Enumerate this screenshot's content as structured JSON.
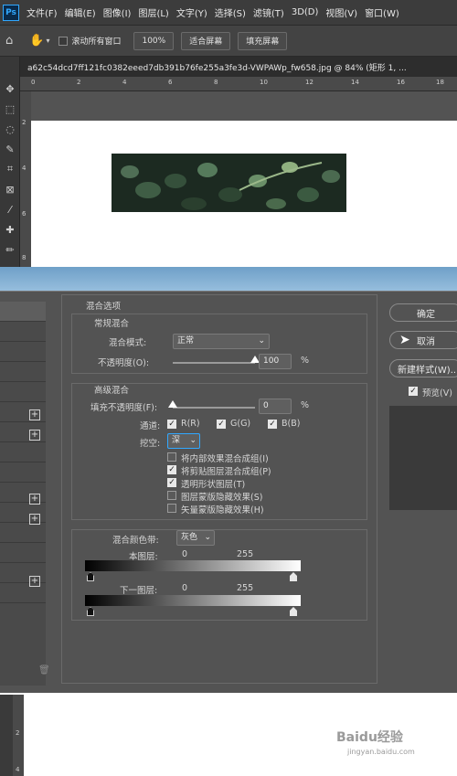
{
  "app": {
    "logo": "Ps"
  },
  "menubar": {
    "items": [
      "文件(F)",
      "编辑(E)",
      "图像(I)",
      "图层(L)",
      "文字(Y)",
      "选择(S)",
      "滤镜(T)",
      "3D(D)",
      "视图(V)",
      "窗口(W)"
    ]
  },
  "options": {
    "scroll_all_label": "滚动所有窗口",
    "zoom_value": "100%",
    "fit_screen": "适合屏幕",
    "fill_screen": "填充屏幕"
  },
  "document": {
    "tab_title": "a62c54dcd7ff121fc0382eeed7db391b76fe255a3fe3d-VWPAWp_fw658.jpg @ 84% (矩形 1, ..."
  },
  "ruler": {
    "top_ticks": [
      "0",
      "2",
      "4",
      "6",
      "8",
      "10",
      "12",
      "14",
      "16",
      "18"
    ],
    "left_ticks": [
      "2",
      "4",
      "6",
      "8"
    ],
    "bottom_left_ticks": [
      "2",
      "4"
    ]
  },
  "dialog": {
    "blend_options": "混合选项",
    "general_blending": "常规混合",
    "blend_mode_label": "混合模式:",
    "blend_mode_value": "正常",
    "opacity_label": "不透明度(O):",
    "opacity_value": "100",
    "opacity_level": 1.0,
    "percent": "%",
    "advanced_blending": "高级混合",
    "fill_opacity_label": "填充不透明度(F):",
    "fill_opacity_value": "0",
    "fill_level": 0.0,
    "channels_label": "通道:",
    "channels": [
      {
        "label": "R(R)",
        "checked": true
      },
      {
        "label": "G(G)",
        "checked": true
      },
      {
        "label": "B(B)",
        "checked": true
      }
    ],
    "knockout_label": "挖空:",
    "knockout_value": "深",
    "options": [
      {
        "label": "将内部效果混合成组(I)",
        "checked": false
      },
      {
        "label": "将剪贴图层混合成组(P)",
        "checked": true
      },
      {
        "label": "透明形状图层(T)",
        "checked": true
      },
      {
        "label": "图层蒙版隐藏效果(S)",
        "checked": false
      },
      {
        "label": "矢量蒙版隐藏效果(H)",
        "checked": false
      }
    ],
    "blend_if_label": "混合颜色带:",
    "blend_if_value": "灰色",
    "this_layer_label": "本图层:",
    "this_layer_min": "0",
    "this_layer_max": "255",
    "underlying_label": "下一图层:",
    "underlying_min": "0",
    "underlying_max": "255",
    "ok_label": "确定",
    "cancel_label": "取消",
    "new_style_label": "新建样式(W)...",
    "preview_label": "预览(V)",
    "preview_checked": true
  },
  "watermark": {
    "brand": "Baidu经验",
    "url": "jingyan.baidu.com"
  },
  "colors": {
    "accent": "#31a8ff",
    "dialog_bg": "#535353",
    "menubar_bg": "#3c3c3c"
  }
}
